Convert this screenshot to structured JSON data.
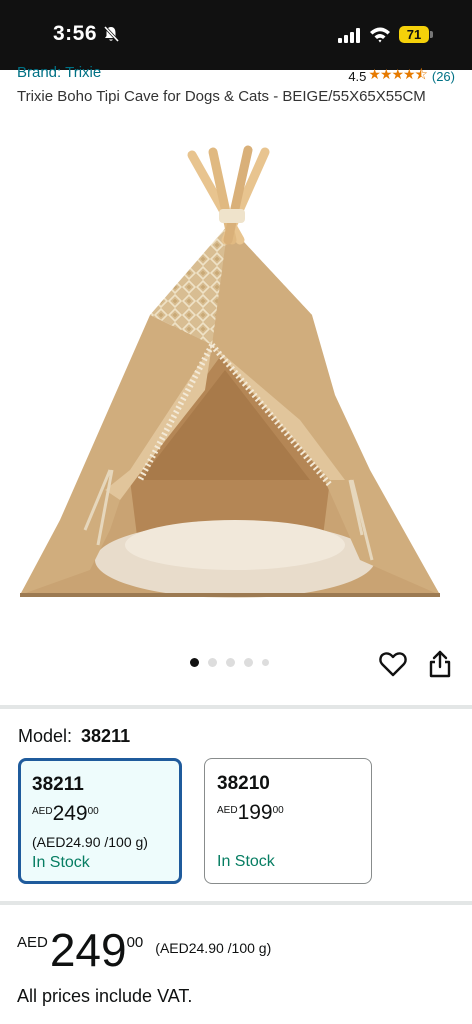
{
  "status_bar": {
    "time": "3:56",
    "battery": "71"
  },
  "product": {
    "brand": "Brand: Trixie",
    "rating_value": "4.5",
    "rating_count": "(26)",
    "rating_stars": 4.5,
    "title": "Trixie Boho Tipi Cave for Dogs & Cats - BEIGE/55X65X55CM"
  },
  "gallery": {
    "total_images": 5,
    "active_index": 0
  },
  "model": {
    "label": "Model:",
    "selected": "38211",
    "options": [
      {
        "name": "38211",
        "currency": "AED",
        "whole": "249",
        "fraction": "00",
        "unit_price": "(AED24.90 /100 g)",
        "stock": "In Stock"
      },
      {
        "name": "38210",
        "currency": "AED",
        "whole": "199",
        "fraction": "00",
        "unit_price": "",
        "stock": "In Stock"
      }
    ]
  },
  "price": {
    "currency": "AED",
    "whole": "249",
    "fraction": "00",
    "unit_price": "(AED24.90 /100 g)"
  },
  "vat_note": "All prices include VAT.",
  "colors": {
    "link": "#007185",
    "stock": "#067d62",
    "selected_border": "#1f5b9c",
    "star": "#e67a00"
  }
}
